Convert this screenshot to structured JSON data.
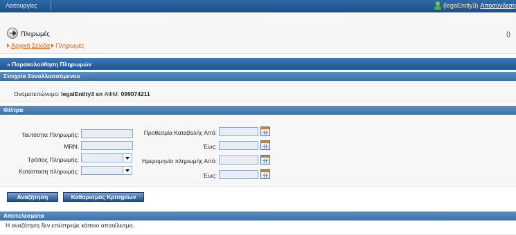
{
  "topbar": {
    "menu_label": "Λειτουργίες",
    "separator": "|",
    "user_name": "(legaEntity3)",
    "logout_label": "Αποσύνδεση"
  },
  "header": {
    "title": "Πληρωμές",
    "right_text": "()",
    "breadcrumb": {
      "home": "Αρχική Σελίδα",
      "current": "Πληρωμές"
    }
  },
  "monitor_bar": {
    "label": "» Παρακολούθηση Πληρωμών"
  },
  "entity_section": {
    "title": "Στοιχεία Συναλλασσόμενου",
    "name_label": "Ονοματεπώνυμο:",
    "name_value": "legalEntity3 sn",
    "afm_label": "ΑΦΜ:",
    "afm_value": "099074211"
  },
  "filters": {
    "title": "Φίλτρα",
    "left": [
      {
        "label": "Ταυτότητα Πληρωμής:",
        "value": "",
        "kind": "input"
      },
      {
        "label": "MRN:",
        "value": "",
        "kind": "input"
      },
      {
        "label": "Τρόπος Πληρωμής:",
        "value": "",
        "kind": "select"
      },
      {
        "label": "Κατάσταση πληρωμής:",
        "value": "",
        "kind": "select"
      }
    ],
    "right": [
      {
        "label": "Προθεσμία Καταβολής Από:",
        "value": ""
      },
      {
        "label": "Έως:",
        "value": ""
      },
      {
        "label": "Ημερομηνία πληρωμής Από:",
        "value": ""
      },
      {
        "label": "Έως:",
        "value": ""
      }
    ]
  },
  "actions": {
    "search_label": "Αναζήτηση",
    "clear_label": "Καθαρισμός Κριτηρίων"
  },
  "results": {
    "title": "Αποτελέσματα",
    "message": "Η αναζήτηση δεν επέστρεψε κάποιο αποτέλεσμα."
  },
  "colors": {
    "topbar": "#1d4f88",
    "section_header": "#3d6fa8",
    "breadcrumb": "#d8641c",
    "field_bg": "#e9eef6"
  },
  "icons": [
    "user-icon",
    "payments-icon",
    "breadcrumb-arrow-icon",
    "calendar-icon",
    "dropdown-arrow-icon"
  ]
}
